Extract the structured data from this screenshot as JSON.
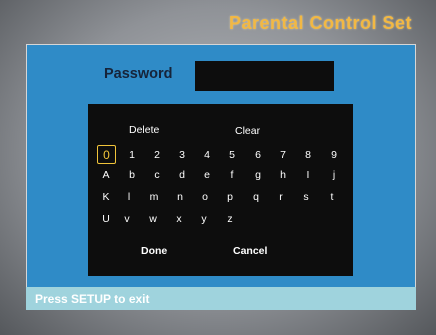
{
  "title": "Parental Control Set",
  "password": {
    "label": "Password",
    "value": ""
  },
  "keyboard": {
    "delete_label": "Delete",
    "clear_label": "Clear",
    "rows": [
      [
        "0",
        "1",
        "2",
        "3",
        "4",
        "5",
        "6",
        "7",
        "8",
        "9"
      ],
      [
        "A",
        "b",
        "c",
        "d",
        "e",
        "f",
        "g",
        "h",
        "I",
        "j"
      ],
      [
        "K",
        "l",
        "m",
        "n",
        "o",
        "p",
        "q",
        "r",
        "s",
        "t"
      ],
      [
        "U",
        "v",
        "w",
        "x",
        "y",
        "z"
      ]
    ],
    "selected_key": "0",
    "done_label": "Done",
    "cancel_label": "Cancel"
  },
  "status": {
    "hint": "Press SETUP to exit"
  },
  "colors": {
    "title": "#f2b843",
    "panel": "#2f8bc7",
    "keyboard_bg": "#0d0d0d",
    "selection": "#f0c43a",
    "status_bar": "#9fd3dd"
  }
}
